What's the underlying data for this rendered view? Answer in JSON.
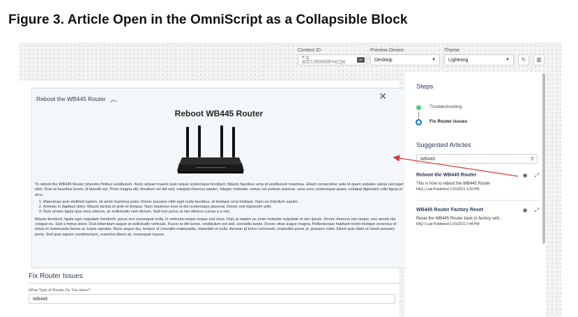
{
  "figure_title": "Figure 3. Article Open in the OmniScript as a Collapsible Block",
  "toolbar": {
    "context_id_label": "Context ID",
    "context_id_placeholder": "e.g. a0Z1J00000FHCQe",
    "context_btn": "ID",
    "preview_device_label": "Preview Device",
    "preview_device_value": "Desktop",
    "theme_label": "Theme",
    "theme_value": "Lightning"
  },
  "article": {
    "header": "Reboot the WB445 Router",
    "title": "Reboot WB445 Router",
    "para1": "To reboot the WB445 Router pharetra finibus vestibulum. Nunc aliquet mauris quis neque scelerisque tincidunt. Mauris faucibus urna id vestibulum maximus. Etiam consectetur ante id quam sodales varius sed eget nibh. Duis at faucibus lorem, id blandit nisi. Proin magna elit, tincidunt vel elit sed, volutpat rhoncus sapien. Integer molestie, metus vel pretium pulvinar, urna nunc scelerisque quam, volutpat dignissim odio ligula et arcu.",
    "list": [
      "Maecenas quis eleifend sapien, sit amet maximus justo. Donec posuere nibh eget nulla faucibus, at tristique urna tristique. Nam eu interdum sapien.",
      "Aenean in dapibus dolor. Mauris lacinia et ante et tempus. Nam maximus eros et dui scelerisque placerat. Donec sed dignissim velit.",
      "Duis ornare ligula quis risus ultrices, ac sollicitudin sem dictum. Sed non purus at nisi ultrices cursus a a nisi."
    ],
    "para2": "Mauris tincidunt, ligula eget vulputate hendrerit, purus orci consequat nulla, in vehicula neque neque sed risus. Duis at sapien ac enim molestie vulputate et nec ipsum. Donec rhoncus nisi neque, nec iaculis dui congue eu. Sed a metus dolor. Duis bibendum augue at sollicitudin vehicula. Fusce at elit luctus, vestibulum est sed, convallis turpis. Donec vitae augue magna. Pellentesque habitant morbi tristique senectus et netus et malesuada fames ac turpis egestas. Nunc augue dui, tempor ut convallis malesuada, imperdiet et nulla. Aenean id tortor commodo, imperdiet purus ut, posuere enim. Etiam quis diam ut lorem posuere porta. Sed quis sapien condimentum, maximus libero at, consequat massa."
  },
  "fix": {
    "title": "Fix Router Issues",
    "field_label": "What Type of Router Do You Have?",
    "field_value": "WB445"
  },
  "panel": {
    "steps_title": "Steps",
    "steps": [
      "Troubleshooting",
      "Fix Router Issues"
    ],
    "suggested_title": "Suggested Articles",
    "search_value": "WB445",
    "articles": [
      {
        "title": "Reboot the WB445 Router",
        "desc": "This is how to reboot the WB445 Router",
        "meta": "FAQ | Last Published 1/15/2021 3:03 PM"
      },
      {
        "title": "WB445 Router Factory Reset",
        "desc": "Reset the WB445 Router back to factory sett...",
        "meta": "FAQ | Last Published 1/15/2021 2:44 PM"
      }
    ]
  },
  "colors": {
    "accent": "#0176d3",
    "success": "#4bca81",
    "arrow": "#d93a3a"
  }
}
